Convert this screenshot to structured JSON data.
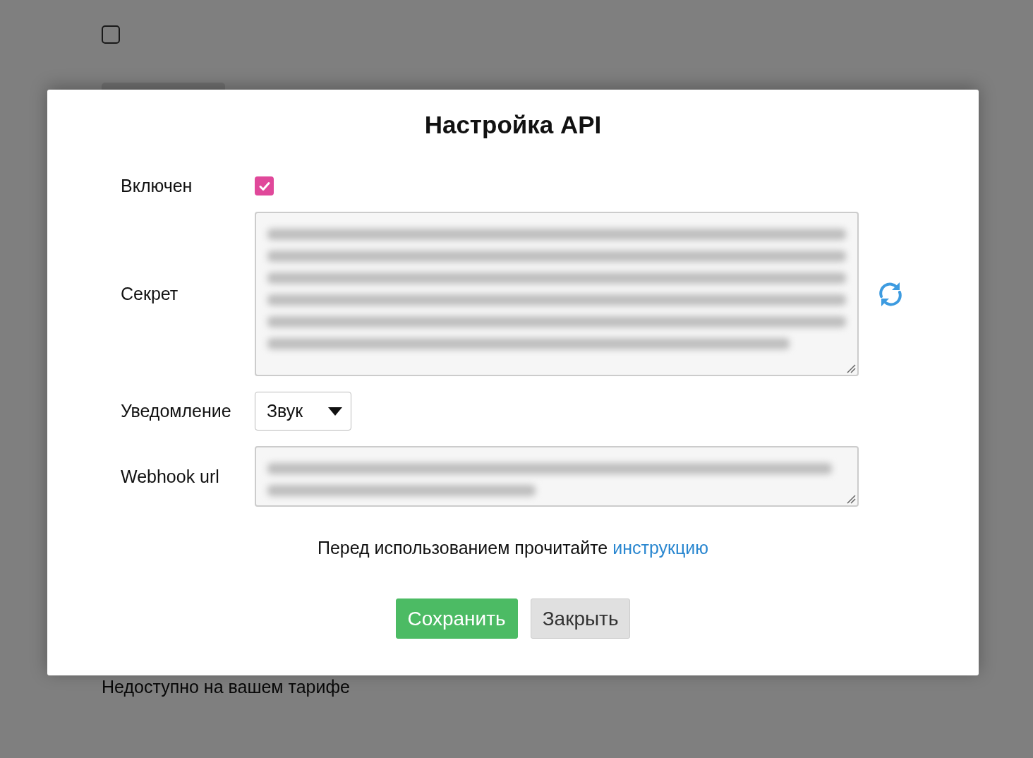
{
  "page": {
    "checkbox": {
      "checked": false
    },
    "notice": "Недоступно на вашем тарифе"
  },
  "dialog": {
    "title": "Настройка API",
    "fields": [
      {
        "kind": "checkbox",
        "label": "Включен",
        "checked": true
      },
      {
        "kind": "secret",
        "label": "Секрет"
      },
      {
        "kind": "select",
        "label": "Уведомление",
        "value": "Звук"
      },
      {
        "kind": "url",
        "label": "Webhook url"
      }
    ],
    "note": {
      "text": "Перед использованием прочитайте",
      "link": "инструкцию"
    },
    "buttons": [
      {
        "kind": "primary",
        "label": "Сохранить"
      },
      {
        "kind": "secondary",
        "label": "Закрыть"
      }
    ]
  }
}
